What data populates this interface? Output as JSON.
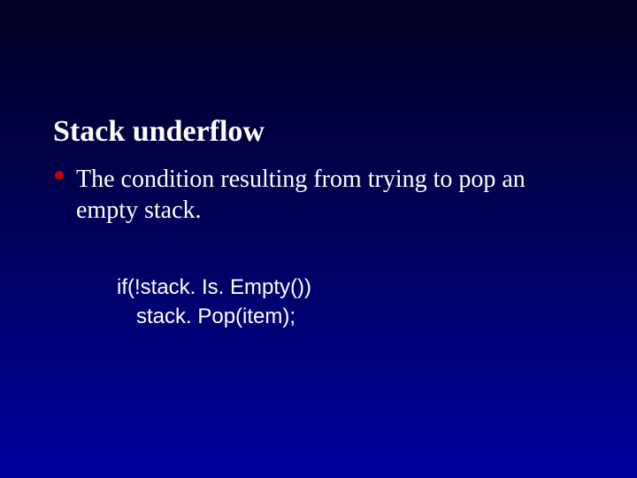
{
  "title": "Stack underflow",
  "bullet1": "The condition resulting from trying to pop an empty stack.",
  "code": {
    "line1": "if(!stack. Is. Empty())",
    "line2": "stack. Pop(item);"
  }
}
